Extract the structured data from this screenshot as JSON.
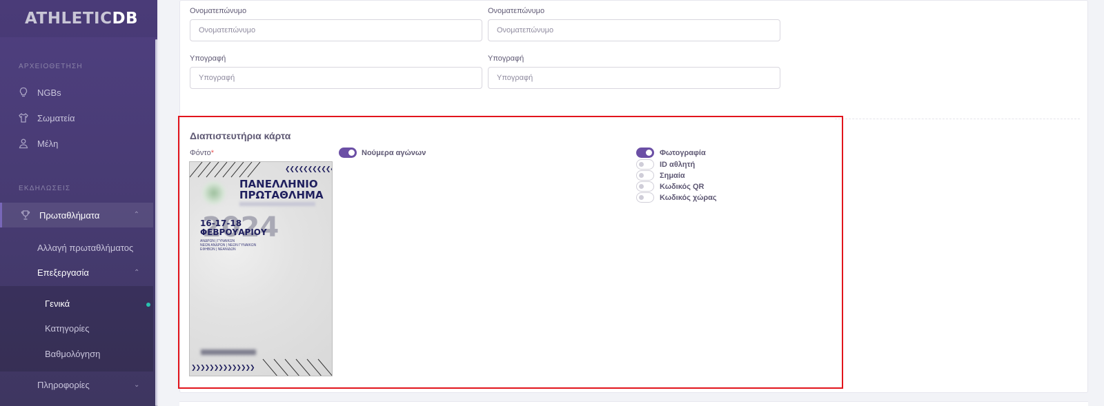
{
  "sidebar": {
    "logo": {
      "part1": "ATHLETIC",
      "part2": "DB"
    },
    "sections": {
      "archive": "ΑΡΧΕΙΟΘΕΤΗΣΗ",
      "events": "ΕΚΔΗΛΩΣΕΙΣ"
    },
    "items": [
      {
        "label": "NGBs",
        "icon": "lightbulb-icon"
      },
      {
        "label": "Σωματεία",
        "icon": "shirt-icon"
      },
      {
        "label": "Μέλη",
        "icon": "user-icon"
      },
      {
        "label": "Πρωταθλήματα",
        "icon": "trophy-icon"
      }
    ],
    "sub": {
      "change": "Αλλαγή πρωταθλήματος",
      "edit": "Επεξεργασία",
      "general": "Γενικά",
      "categories": "Κατηγορίες",
      "scoring": "Βαθμολόγηση",
      "info": "Πληροφορίες"
    }
  },
  "form": {
    "name_label_1": "Ονοματεπώνυμο",
    "name_placeholder_1": "Ονοματεπώνυμο",
    "name_label_2": "Ονοματεπώνυμο",
    "name_placeholder_2": "Ονοματεπώνυμο",
    "sig_label_1": "Υπογραφή",
    "sig_placeholder_1": "Υπογραφή",
    "sig_label_2": "Υπογραφή",
    "sig_placeholder_2": "Υπογραφή"
  },
  "card": {
    "title": "Διαπιστευτήρια κάρτα",
    "background_label": "Φόντο",
    "required_mark": "*",
    "poster": {
      "title_line1": "ΠΑΝΕΛΛΗΝΙΟ",
      "title_line2": "ΠΡΩΤΑΘΛΗΜΑ",
      "date_line1": "16-17-18",
      "date_line2": "ΦΕΒΡΟΥΑΡΙΟΥ",
      "year": "2024",
      "small1": "ΑΝΔΡΩΝ | ΓΥΝΑΙΚΩΝ",
      "small2": "ΝΕΩΝ ΑΝΔΡΩΝ | ΝΕΩΝ ΓΥΝΑΙΚΩΝ",
      "small3": "ΕΦΗΒΩΝ | ΝΕΑΝΙΔΩΝ"
    },
    "toggles": [
      {
        "label": "Νούμερα αγώνων",
        "on": true
      },
      {
        "label": "Φωτογραφία",
        "on": true
      },
      {
        "label": "ID αθλητή",
        "on": false
      },
      {
        "label": "Σημαία",
        "on": false
      },
      {
        "label": "Κωδικός QR",
        "on": false
      },
      {
        "label": "Κωδικός χώρας",
        "on": false
      }
    ]
  },
  "colors": {
    "sidebar": "#4b3d7a",
    "accent": "#6b4fa5",
    "highlight_box": "#e2141c",
    "active_dot": "#28c2b0"
  }
}
